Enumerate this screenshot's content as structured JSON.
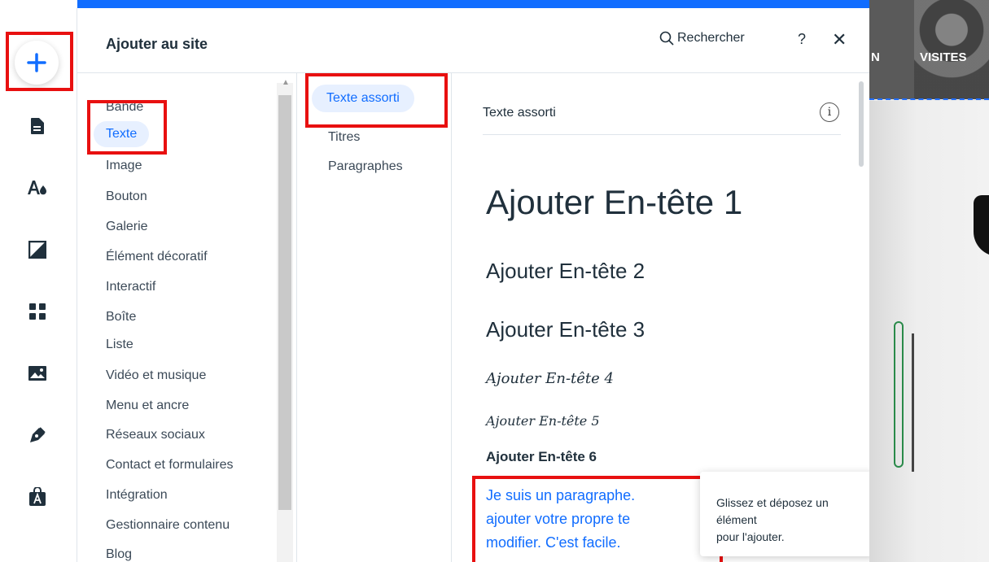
{
  "panel": {
    "title": "Ajouter au site",
    "search_label": "Rechercher",
    "help_label": "?",
    "close_label": "✕"
  },
  "categories": [
    "Bande",
    "Texte",
    "Image",
    "Bouton",
    "Galerie",
    "Élément décoratif",
    "Interactif",
    "Boîte",
    "Liste",
    "Vidéo et musique",
    "Menu et ancre",
    "Réseaux sociaux",
    "Contact et formulaires",
    "Intégration",
    "Gestionnaire contenu",
    "Blog"
  ],
  "selected_category": "Texte",
  "subcategories": [
    "Texte assorti",
    "Titres",
    "Paragraphes"
  ],
  "selected_subcategory": "Texte assorti",
  "content": {
    "section_title": "Texte assorti",
    "h1": "Ajouter En-tête 1",
    "h2": "Ajouter En-tête 2",
    "h3": "Ajouter En-tête 3",
    "h4": "Ajouter En-tête 4",
    "h5": "Ajouter En-tête 5",
    "h6": "Ajouter En-tête 6",
    "paragraph_lines": [
      "Je suis un paragraphe.",
      "ajouter votre propre te",
      "modifier. C'est facile."
    ]
  },
  "tooltip": {
    "line1": "Glissez et déposez un élément",
    "line2": "pour l'ajouter."
  },
  "preview": {
    "nav_partial": "N",
    "nav_visites": "VISITES"
  },
  "colors": {
    "accent": "#116dff",
    "highlight": "#e81010",
    "selected_bg": "#e7f0ff"
  },
  "toolbar_icons": [
    "add-icon",
    "pages-icon",
    "theme-icon",
    "background-icon",
    "apps-icon",
    "media-icon",
    "blog-icon",
    "business-icon"
  ]
}
